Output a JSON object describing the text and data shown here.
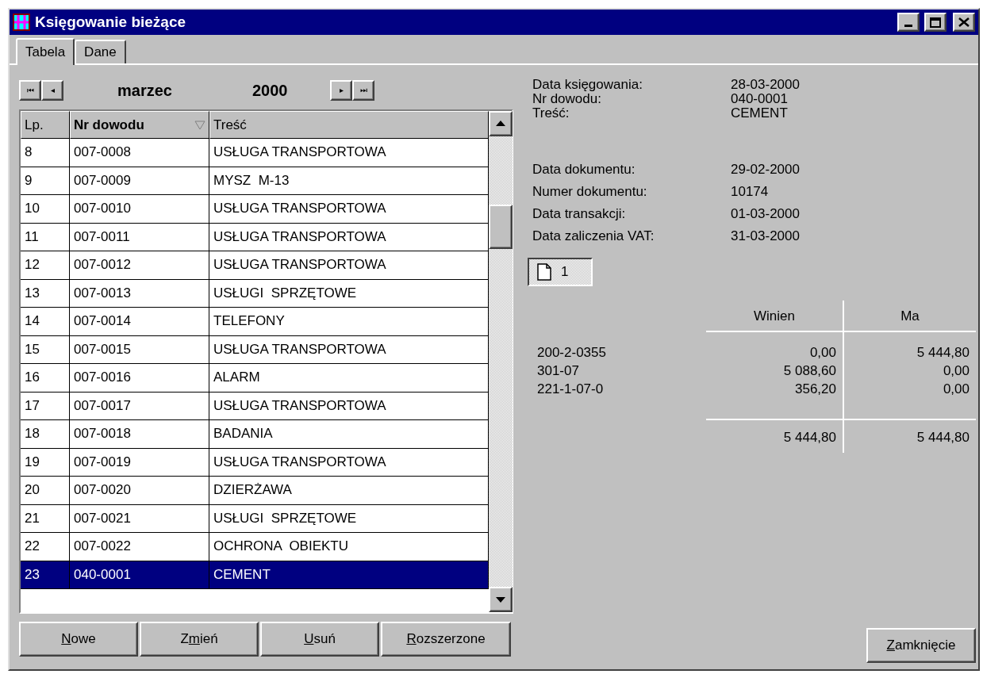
{
  "window": {
    "title": "Księgowanie bieżące"
  },
  "tabs": [
    {
      "label": "Tabela",
      "selected": true
    },
    {
      "label": "Dane",
      "selected": false
    }
  ],
  "period": {
    "first": "⏮",
    "prev": "◂",
    "month": "marzec",
    "year": "2000",
    "next": "▸",
    "last": "⏭"
  },
  "table": {
    "columns": [
      {
        "label": "Lp.",
        "sorted": false
      },
      {
        "label": "Nr dowodu",
        "sorted": true
      },
      {
        "label": "Treść",
        "sorted": false
      }
    ],
    "rows": [
      {
        "lp": "8",
        "nr": "007-0008",
        "tresc": "USŁUGA TRANSPORTOWA",
        "selected": false
      },
      {
        "lp": "9",
        "nr": "007-0009",
        "tresc": "MYSZ  M-13",
        "selected": false
      },
      {
        "lp": "10",
        "nr": "007-0010",
        "tresc": "USŁUGA TRANSPORTOWA",
        "selected": false
      },
      {
        "lp": "11",
        "nr": "007-0011",
        "tresc": "USŁUGA TRANSPORTOWA",
        "selected": false
      },
      {
        "lp": "12",
        "nr": "007-0012",
        "tresc": "USŁUGA TRANSPORTOWA",
        "selected": false
      },
      {
        "lp": "13",
        "nr": "007-0013",
        "tresc": "USŁUGI  SPRZĘTOWE",
        "selected": false
      },
      {
        "lp": "14",
        "nr": "007-0014",
        "tresc": "TELEFONY",
        "selected": false
      },
      {
        "lp": "15",
        "nr": "007-0015",
        "tresc": "USŁUGA TRANSPORTOWA",
        "selected": false
      },
      {
        "lp": "16",
        "nr": "007-0016",
        "tresc": "ALARM",
        "selected": false
      },
      {
        "lp": "17",
        "nr": "007-0017",
        "tresc": "USŁUGA TRANSPORTOWA",
        "selected": false
      },
      {
        "lp": "18",
        "nr": "007-0018",
        "tresc": "BADANIA",
        "selected": false
      },
      {
        "lp": "19",
        "nr": "007-0019",
        "tresc": "USŁUGA TRANSPORTOWA",
        "selected": false
      },
      {
        "lp": "20",
        "nr": "007-0020",
        "tresc": "DZIERŻAWA",
        "selected": false
      },
      {
        "lp": "21",
        "nr": "007-0021",
        "tresc": "USŁUGI  SPRZĘTOWE",
        "selected": false
      },
      {
        "lp": "22",
        "nr": "007-0022",
        "tresc": "OCHRONA  OBIEKTU",
        "selected": false
      },
      {
        "lp": "23",
        "nr": "040-0001",
        "tresc": "CEMENT",
        "selected": true
      }
    ]
  },
  "buttons": [
    {
      "accel": "N",
      "after": "owe"
    },
    {
      "before": "Z",
      "accel": "m",
      "after": "ień"
    },
    {
      "accel": "U",
      "after": "suń"
    },
    {
      "accel": "R",
      "after": "ozszerzone"
    }
  ],
  "details": {
    "group_1": [
      {
        "label": "Data księgowania:",
        "value": "28-03-2000"
      },
      {
        "label": "Nr dowodu:",
        "value": "040-0001"
      },
      {
        "label": "Treść:",
        "value": "CEMENT"
      }
    ],
    "group_2": [
      {
        "label": "Data dokumentu:",
        "value": "29-02-2000"
      },
      {
        "label": "Numer dokumentu:",
        "value": "10174"
      },
      {
        "label": "Data transakcji:",
        "value": "01-03-2000"
      },
      {
        "label": "Data zaliczenia VAT:",
        "value": "31-03-2000"
      }
    ]
  },
  "document_button": {
    "label": "1"
  },
  "ledger": {
    "columns": [
      "Winien",
      "Ma"
    ],
    "rows": [
      {
        "account": "200-2-0355",
        "winien": "0,00",
        "ma": "5 444,80"
      },
      {
        "account": "301-07",
        "winien": "5 088,60",
        "ma": "0,00"
      },
      {
        "account": "221-1-07-0",
        "winien": "356,20",
        "ma": "0,00"
      }
    ],
    "totals": {
      "winien": "5 444,80",
      "ma": "5 444,80"
    }
  },
  "close_button": {
    "accel": "Z",
    "after": "amknięcie"
  }
}
